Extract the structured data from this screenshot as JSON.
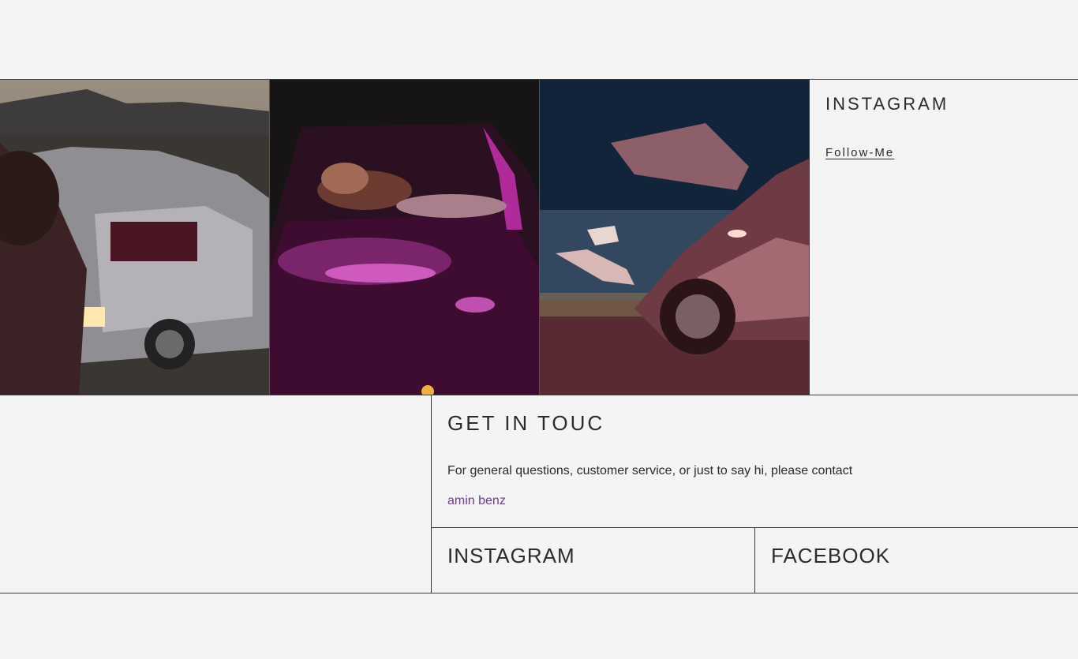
{
  "gallery": {
    "photos": [
      {
        "alt": "Woman beside silver gull-wing car in desert at dusk"
      },
      {
        "alt": "Woman leaning in car under magenta light"
      },
      {
        "alt": "Legs in heels out of car window at night"
      }
    ],
    "instagram_title": "INSTAGRAM",
    "follow_label": "Follow-Me"
  },
  "contact": {
    "title": "GET IN TOUC",
    "text": "For general questions, customer service, or just to say hi, please contact",
    "link": "amin benz",
    "link_color": "#6a3a8f"
  },
  "social": {
    "instagram": "INSTAGRAM",
    "facebook": "FACEBOOK"
  }
}
